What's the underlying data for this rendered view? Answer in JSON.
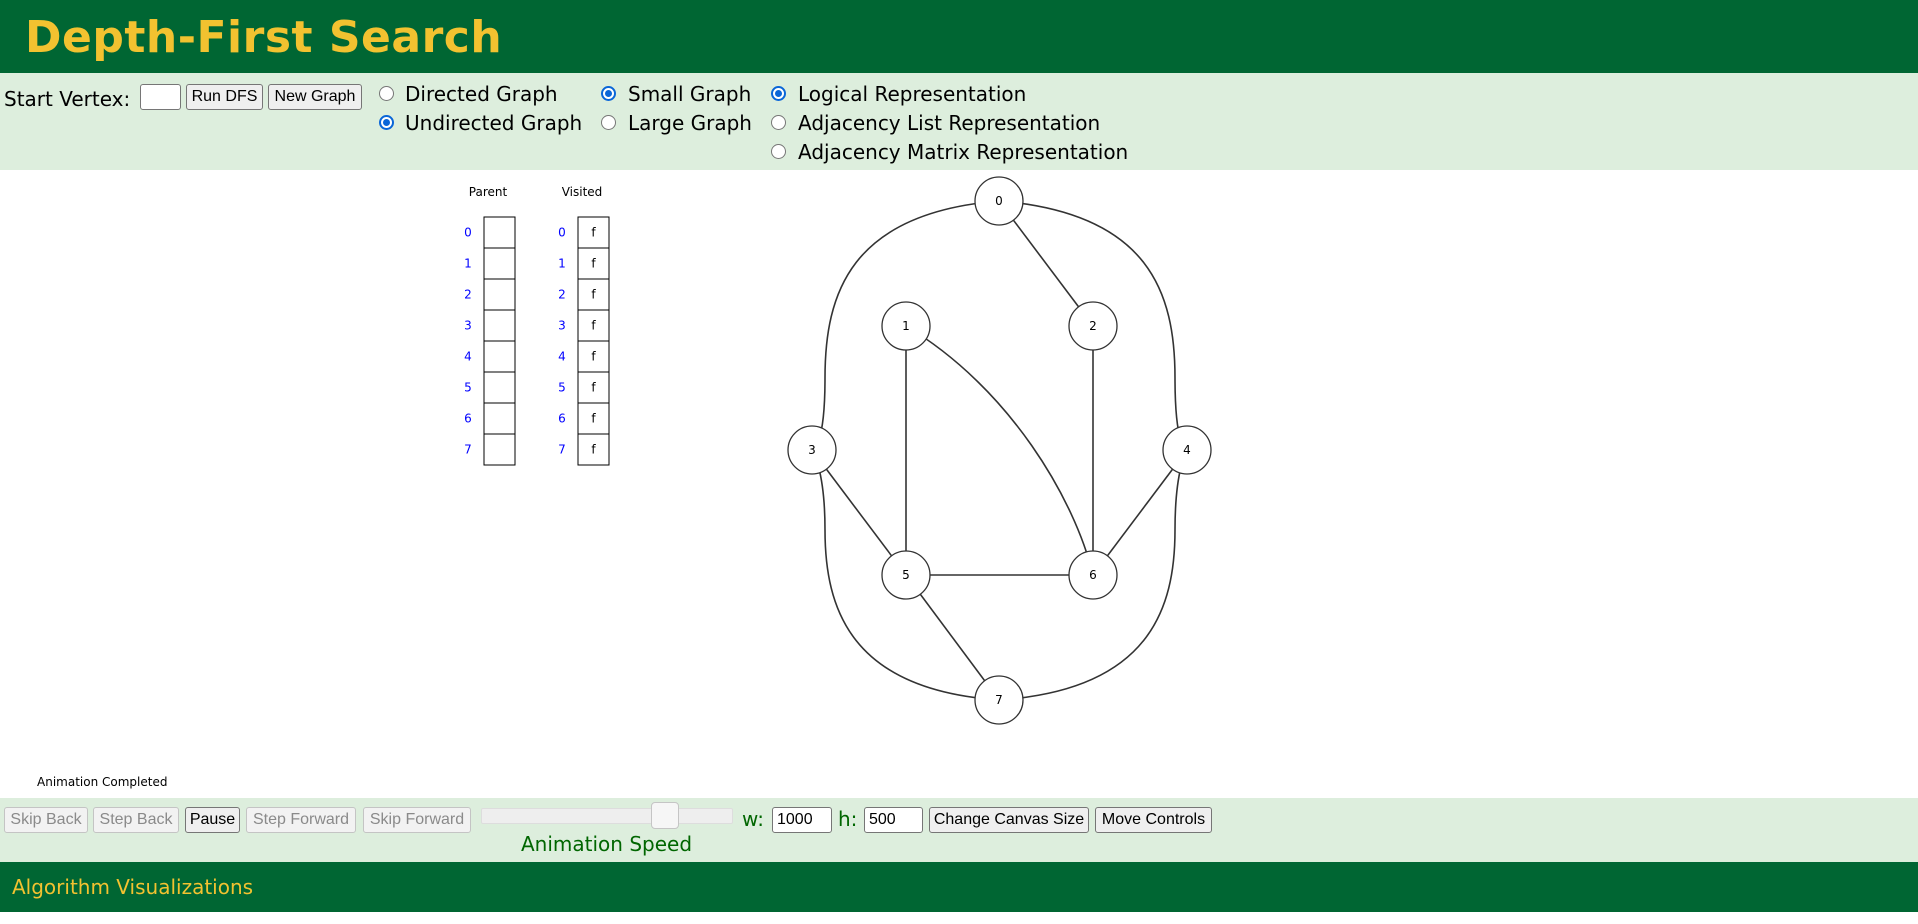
{
  "header": {
    "title": "Depth-First Search"
  },
  "controls": {
    "start_vertex_label": "Start Vertex:",
    "start_vertex_value": "",
    "run_button": "Run DFS",
    "new_graph_button": "New Graph",
    "graph_type": {
      "directed": "Directed Graph",
      "undirected": "Undirected Graph",
      "selected": "Undirected Graph"
    },
    "graph_size": {
      "small": "Small Graph",
      "large": "Large Graph",
      "selected": "Small Graph"
    },
    "representation": {
      "logical": "Logical Representation",
      "adjacency_list": "Adjacency List Representation",
      "adjacency_matrix": "Adjacency Matrix Representation",
      "selected": "Logical Representation"
    }
  },
  "tables": {
    "parent_header": "Parent",
    "visited_header": "Visited",
    "indices": [
      "0",
      "1",
      "2",
      "3",
      "4",
      "5",
      "6",
      "7"
    ],
    "parent_values": [
      "",
      "",
      "",
      "",
      "",
      "",
      "",
      ""
    ],
    "visited_values": [
      "f",
      "f",
      "f",
      "f",
      "f",
      "f",
      "f",
      "f"
    ]
  },
  "graph": {
    "vertices": [
      "0",
      "1",
      "2",
      "3",
      "4",
      "5",
      "6",
      "7"
    ],
    "edges": [
      [
        "0",
        "2"
      ],
      [
        "0",
        "3"
      ],
      [
        "0",
        "4"
      ],
      [
        "1",
        "5"
      ],
      [
        "1",
        "6"
      ],
      [
        "2",
        "6"
      ],
      [
        "3",
        "5"
      ],
      [
        "3",
        "7"
      ],
      [
        "4",
        "6"
      ],
      [
        "4",
        "7"
      ],
      [
        "5",
        "6"
      ],
      [
        "5",
        "7"
      ]
    ]
  },
  "status": "Animation Completed",
  "playback": {
    "skip_back": "Skip Back",
    "step_back": "Step Back",
    "pause": "Pause",
    "step_forward": "Step Forward",
    "skip_forward": "Skip Forward",
    "speed_label": "Animation Speed",
    "speed_fraction": 0.76
  },
  "canvas_size": {
    "w_label": "w:",
    "w_value": "1000",
    "h_label": "h:",
    "h_value": "500",
    "change_button": "Change Canvas Size",
    "move_button": "Move Controls"
  },
  "footer": {
    "link": "Algorithm Visualizations"
  },
  "colors": {
    "header_bg": "#006633",
    "title": "#f2c230",
    "panel_bg": "#ddeedd",
    "index_label": "#0000ff",
    "accent_green": "#006600"
  }
}
